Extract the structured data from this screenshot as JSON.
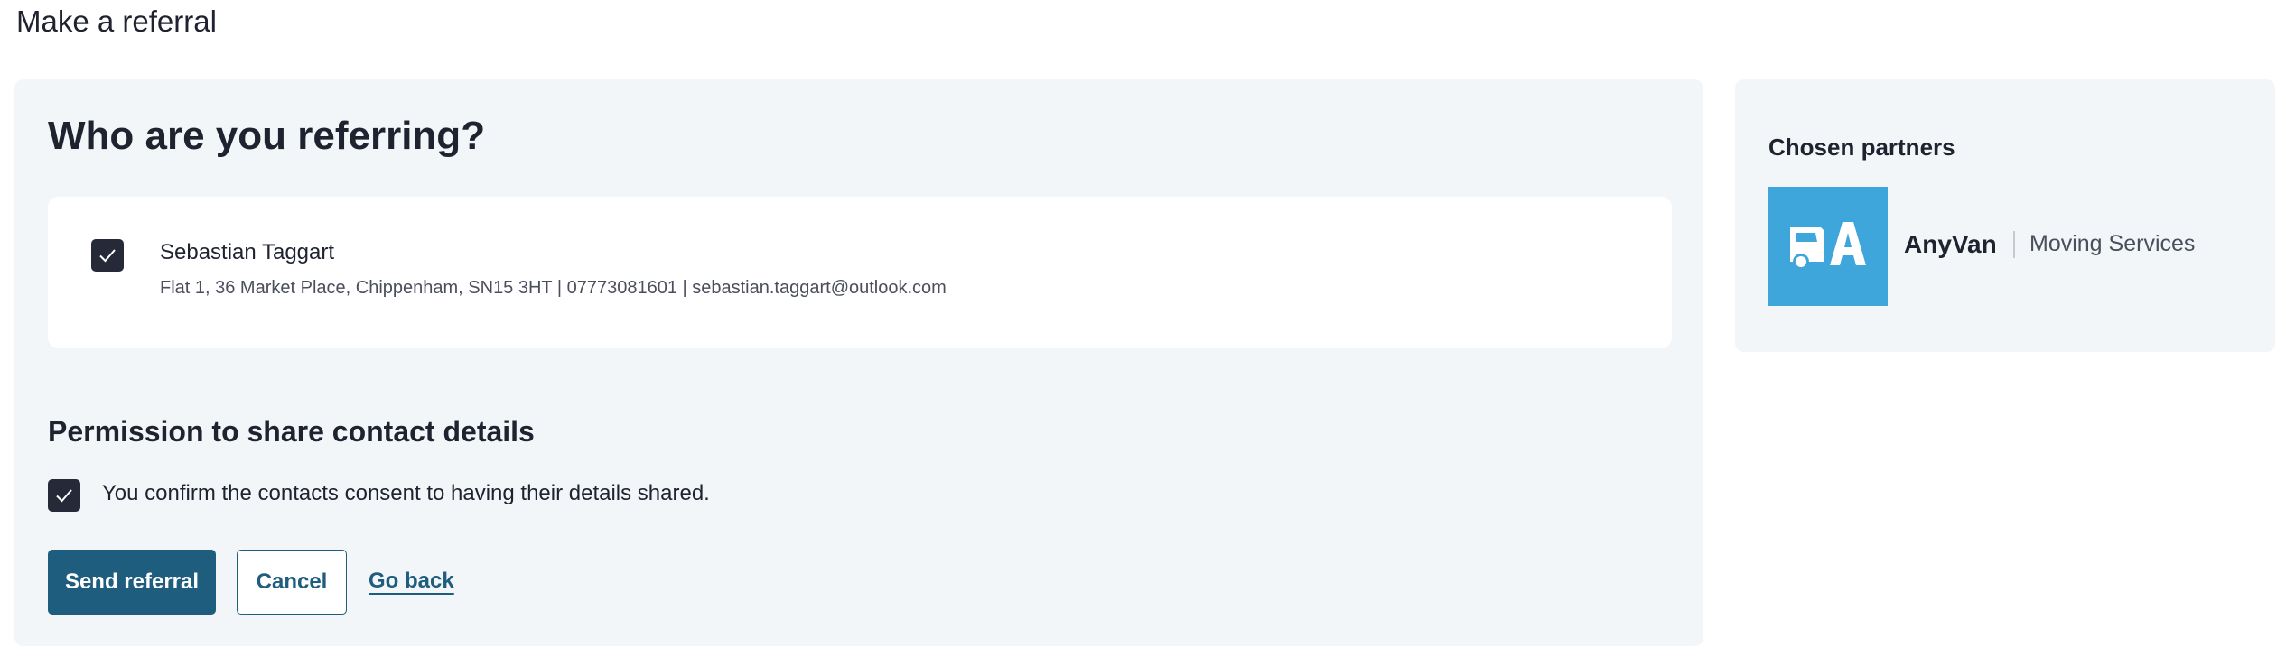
{
  "page": {
    "title": "Make a referral"
  },
  "referral": {
    "heading": "Who are you referring?",
    "contact": {
      "name": "Sebastian Taggart",
      "details": "Flat 1, 36 Market Place, Chippenham, SN15 3HT | 07773081601 | sebastian.taggart@outlook.com",
      "selected": true
    },
    "permission": {
      "heading": "Permission to share contact details",
      "consent_label": "You confirm the contacts consent to having their details shared.",
      "consented": true
    },
    "actions": {
      "send_label": "Send referral",
      "cancel_label": "Cancel",
      "back_label": "Go back"
    }
  },
  "partners": {
    "heading": "Chosen partners",
    "items": [
      {
        "name": "AnyVan",
        "service": "Moving Services",
        "logo_color": "#3fa6dc",
        "logo_icon": "anyvan-logo-icon"
      }
    ]
  },
  "colors": {
    "primary": "#1e5d7e",
    "card_background": "#f3f6f8",
    "checkbox": "#262938",
    "text": "#1f2330"
  }
}
